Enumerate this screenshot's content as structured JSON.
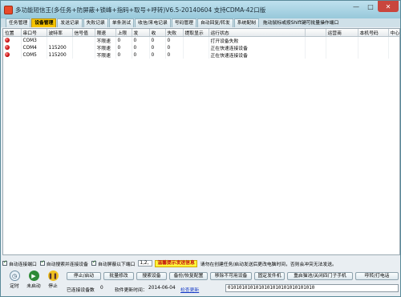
{
  "window": {
    "title": "多功能短信王(多任务+防屏蔽+锁峰+指码+取号+呼转)V6.5-20140604 支持CDMA-42口版",
    "minimize_glyph": "—",
    "maximize_glyph": "□",
    "close_glyph": "✕"
  },
  "tabs": [
    "任务管理",
    "设备管理",
    "发送记录",
    "失败记录",
    "单条测试",
    "收信/来电记录",
    "号码管理",
    "自动回复/转发",
    "系统配制"
  ],
  "active_tab": "设备管理",
  "tab_hint": "拖动鼠标或按Shift键可批量操作端口",
  "grid": {
    "columns": [
      "位置",
      "串口号",
      "波特率",
      "信号值",
      "限速",
      "上限",
      "发",
      "收",
      "失败",
      "提取显示",
      "运行状态",
      "",
      "运营商",
      "本机号码",
      "中心号码"
    ],
    "rows": [
      {
        "port": "COM3",
        "baud": "",
        "signal": "",
        "limit": "不限速",
        "upper": "0",
        "sent": "0",
        "recv": "0",
        "fail": "0",
        "extract": "",
        "status": "打开设备失败"
      },
      {
        "port": "COM4",
        "baud": "115200",
        "signal": "",
        "limit": "不限速",
        "upper": "0",
        "sent": "0",
        "recv": "0",
        "fail": "0",
        "extract": "",
        "status": "正在快速连接设备"
      },
      {
        "port": "COM5",
        "baud": "115200",
        "signal": "",
        "limit": "不限速",
        "upper": "0",
        "sent": "0",
        "recv": "0",
        "fail": "0",
        "extract": "",
        "status": "正在快速连接设备"
      }
    ]
  },
  "options": {
    "auto_connect": "自动连接端口",
    "auto_search": "自动搜索并连接设备",
    "auto_block": "自动屏蔽以下端口",
    "block_ports": "1,2,",
    "warning": "温馨提示发送信息",
    "notice": "请勿在创建任务/启动发送后更改电脑时间，否则会冲突无法发送。"
  },
  "controls": {
    "timer": "定时",
    "not_started": "未启动",
    "stop": "停止"
  },
  "buttons": {
    "stop_start": "停止/启动",
    "batch_modify": "批量修改",
    "search_device": "搜索设备",
    "backup_restore": "备份/恢复配置",
    "remove_unavailable": "移除不可用设备",
    "fixed_send": "固定发件机",
    "restart_module": "重启猫池/关闭四门子手机",
    "call_forward": "呼转/打电话"
  },
  "status": {
    "connected_label": "已连接设备数",
    "connected_count": "0",
    "update_label": "软件更新时间：",
    "update_date": "2014-06-04",
    "check_update": "检查更新",
    "bits": "0101010101010101010101010101010"
  },
  "colors": {
    "active_tab": "#f6c400",
    "status_dot": "#c00000",
    "banner_bg": "#fff63a",
    "banner_text": "#c31010",
    "link": "#1a3ec7"
  }
}
